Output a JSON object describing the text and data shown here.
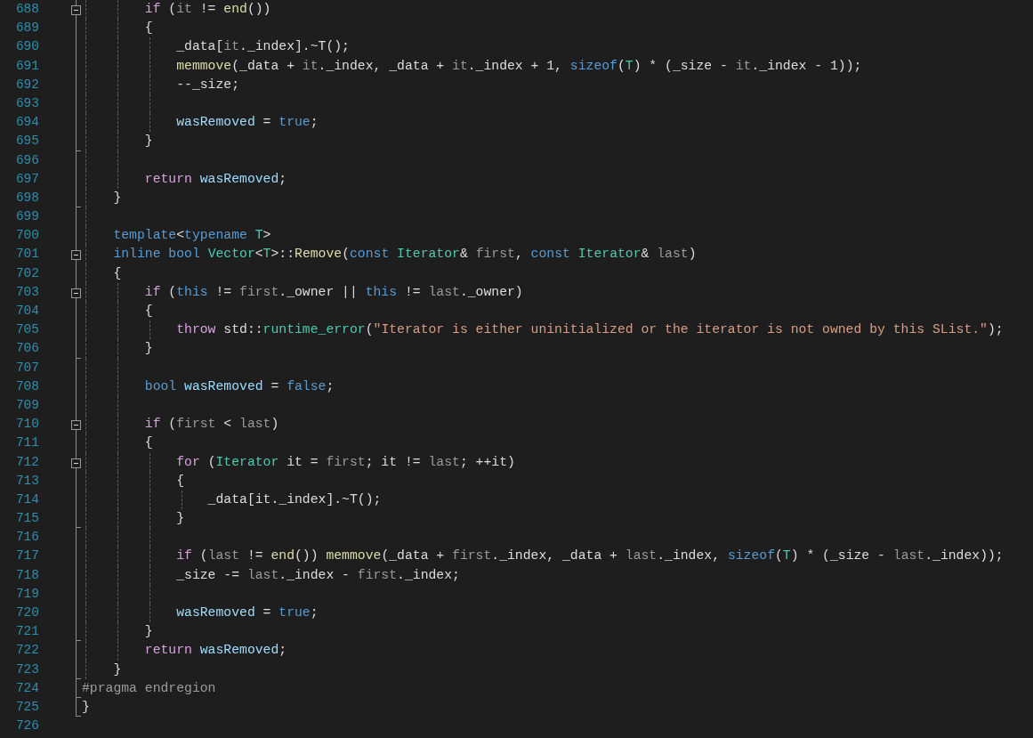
{
  "lines": [
    {
      "number": "688",
      "fold": {
        "expanded": true
      },
      "tokens": [
        {
          "kind": "control",
          "text": "        if"
        },
        {
          "kind": "plain",
          "text": " ("
        },
        {
          "kind": "param",
          "text": "it"
        },
        {
          "kind": "plain",
          "text": " != "
        },
        {
          "kind": "function",
          "text": "end"
        },
        {
          "kind": "plain",
          "text": "())"
        }
      ]
    },
    {
      "number": "689",
      "tokens": [
        {
          "kind": "plain",
          "text": "        {"
        }
      ]
    },
    {
      "number": "690",
      "tokens": [
        {
          "kind": "plain",
          "text": "            _data["
        },
        {
          "kind": "param",
          "text": "it"
        },
        {
          "kind": "plain",
          "text": "._index].~T();"
        }
      ]
    },
    {
      "number": "691",
      "tokens": [
        {
          "kind": "function",
          "text": "            memmove"
        },
        {
          "kind": "plain",
          "text": "(_data + "
        },
        {
          "kind": "param",
          "text": "it"
        },
        {
          "kind": "plain",
          "text": "._index, _data + "
        },
        {
          "kind": "param",
          "text": "it"
        },
        {
          "kind": "plain",
          "text": "._index + 1, "
        },
        {
          "kind": "keyword",
          "text": "sizeof"
        },
        {
          "kind": "plain",
          "text": "("
        },
        {
          "kind": "type",
          "text": "T"
        },
        {
          "kind": "plain",
          "text": ") * (_size - "
        },
        {
          "kind": "param",
          "text": "it"
        },
        {
          "kind": "plain",
          "text": "._index - 1));"
        }
      ]
    },
    {
      "number": "692",
      "tokens": [
        {
          "kind": "plain",
          "text": "            --_size;"
        }
      ]
    },
    {
      "number": "693"
    },
    {
      "number": "694",
      "tokens": [
        {
          "kind": "local",
          "text": "            wasRemoved"
        },
        {
          "kind": "plain",
          "text": " = "
        },
        {
          "kind": "keyword",
          "text": "true"
        },
        {
          "kind": "plain",
          "text": ";"
        }
      ]
    },
    {
      "number": "695",
      "fold_end": true,
      "tokens": [
        {
          "kind": "plain",
          "text": "        }"
        }
      ]
    },
    {
      "number": "696"
    },
    {
      "number": "697",
      "tokens": [
        {
          "kind": "control",
          "text": "        return"
        },
        {
          "kind": "local",
          "text": " wasRemoved"
        },
        {
          "kind": "plain",
          "text": ";"
        }
      ]
    },
    {
      "number": "698",
      "fold_end": true,
      "tokens": [
        {
          "kind": "plain",
          "text": "    }"
        }
      ]
    },
    {
      "number": "699"
    },
    {
      "number": "700",
      "tokens": [
        {
          "kind": "keyword",
          "text": "    template"
        },
        {
          "kind": "plain",
          "text": "<"
        },
        {
          "kind": "keyword",
          "text": "typename"
        },
        {
          "kind": "type",
          "text": " T"
        },
        {
          "kind": "plain",
          "text": ">"
        }
      ]
    },
    {
      "number": "701",
      "fold": {
        "expanded": true
      },
      "tokens": [
        {
          "kind": "keyword",
          "text": "    inline"
        },
        {
          "kind": "keyword",
          "text": " bool"
        },
        {
          "kind": "type",
          "text": " Vector"
        },
        {
          "kind": "plain",
          "text": "<"
        },
        {
          "kind": "type",
          "text": "T"
        },
        {
          "kind": "plain",
          "text": ">::"
        },
        {
          "kind": "function",
          "text": "Remove"
        },
        {
          "kind": "plain",
          "text": "("
        },
        {
          "kind": "keyword",
          "text": "const"
        },
        {
          "kind": "type",
          "text": " Iterator"
        },
        {
          "kind": "plain",
          "text": "& "
        },
        {
          "kind": "param",
          "text": "first"
        },
        {
          "kind": "plain",
          "text": ", "
        },
        {
          "kind": "keyword",
          "text": "const"
        },
        {
          "kind": "type",
          "text": " Iterator"
        },
        {
          "kind": "plain",
          "text": "& "
        },
        {
          "kind": "param",
          "text": "last"
        },
        {
          "kind": "plain",
          "text": ")"
        }
      ]
    },
    {
      "number": "702",
      "tokens": [
        {
          "kind": "plain",
          "text": "    {"
        }
      ]
    },
    {
      "number": "703",
      "fold": {
        "expanded": true
      },
      "tokens": [
        {
          "kind": "control",
          "text": "        if"
        },
        {
          "kind": "plain",
          "text": " ("
        },
        {
          "kind": "keyword",
          "text": "this"
        },
        {
          "kind": "plain",
          "text": " != "
        },
        {
          "kind": "param",
          "text": "first"
        },
        {
          "kind": "plain",
          "text": "._owner || "
        },
        {
          "kind": "keyword",
          "text": "this"
        },
        {
          "kind": "plain",
          "text": " != "
        },
        {
          "kind": "param",
          "text": "last"
        },
        {
          "kind": "plain",
          "text": "._owner)"
        }
      ]
    },
    {
      "number": "704",
      "tokens": [
        {
          "kind": "plain",
          "text": "        {"
        }
      ]
    },
    {
      "number": "705",
      "tokens": [
        {
          "kind": "control",
          "text": "            throw"
        },
        {
          "kind": "plain",
          "text": " std::"
        },
        {
          "kind": "type",
          "text": "runtime_error"
        },
        {
          "kind": "plain",
          "text": "("
        },
        {
          "kind": "string",
          "text": "\"Iterator is either uninitialized or the iterator is not owned by this SList.\""
        },
        {
          "kind": "plain",
          "text": ");"
        }
      ]
    },
    {
      "number": "706",
      "fold_end": true,
      "tokens": [
        {
          "kind": "plain",
          "text": "        }"
        }
      ]
    },
    {
      "number": "707"
    },
    {
      "number": "708",
      "tokens": [
        {
          "kind": "keyword",
          "text": "        bool"
        },
        {
          "kind": "local",
          "text": " wasRemoved"
        },
        {
          "kind": "plain",
          "text": " = "
        },
        {
          "kind": "keyword",
          "text": "false"
        },
        {
          "kind": "plain",
          "text": ";"
        }
      ]
    },
    {
      "number": "709"
    },
    {
      "number": "710",
      "fold": {
        "expanded": true
      },
      "tokens": [
        {
          "kind": "control",
          "text": "        if"
        },
        {
          "kind": "plain",
          "text": " ("
        },
        {
          "kind": "param",
          "text": "first"
        },
        {
          "kind": "plain",
          "text": " < "
        },
        {
          "kind": "param",
          "text": "last"
        },
        {
          "kind": "plain",
          "text": ")"
        }
      ]
    },
    {
      "number": "711",
      "tokens": [
        {
          "kind": "plain",
          "text": "        {"
        }
      ]
    },
    {
      "number": "712",
      "fold": {
        "expanded": true
      },
      "tokens": [
        {
          "kind": "control",
          "text": "            for"
        },
        {
          "kind": "plain",
          "text": " ("
        },
        {
          "kind": "type",
          "text": "Iterator"
        },
        {
          "kind": "plain",
          "text": " it = "
        },
        {
          "kind": "param",
          "text": "first"
        },
        {
          "kind": "plain",
          "text": "; it != "
        },
        {
          "kind": "param",
          "text": "last"
        },
        {
          "kind": "plain",
          "text": "; ++it)"
        }
      ]
    },
    {
      "number": "713",
      "tokens": [
        {
          "kind": "plain",
          "text": "            {"
        }
      ]
    },
    {
      "number": "714",
      "tokens": [
        {
          "kind": "plain",
          "text": "                _data[it._index].~T();"
        }
      ]
    },
    {
      "number": "715",
      "fold_end": true,
      "tokens": [
        {
          "kind": "plain",
          "text": "            }"
        }
      ]
    },
    {
      "number": "716"
    },
    {
      "number": "717",
      "tokens": [
        {
          "kind": "control",
          "text": "            if"
        },
        {
          "kind": "plain",
          "text": " ("
        },
        {
          "kind": "param",
          "text": "last"
        },
        {
          "kind": "plain",
          "text": " != "
        },
        {
          "kind": "function",
          "text": "end"
        },
        {
          "kind": "plain",
          "text": "()) "
        },
        {
          "kind": "function",
          "text": "memmove"
        },
        {
          "kind": "plain",
          "text": "(_data + "
        },
        {
          "kind": "param",
          "text": "first"
        },
        {
          "kind": "plain",
          "text": "._index, _data + "
        },
        {
          "kind": "param",
          "text": "last"
        },
        {
          "kind": "plain",
          "text": "._index, "
        },
        {
          "kind": "keyword",
          "text": "sizeof"
        },
        {
          "kind": "plain",
          "text": "("
        },
        {
          "kind": "type",
          "text": "T"
        },
        {
          "kind": "plain",
          "text": ") * (_size - "
        },
        {
          "kind": "param",
          "text": "last"
        },
        {
          "kind": "plain",
          "text": "._index));"
        }
      ]
    },
    {
      "number": "718",
      "tokens": [
        {
          "kind": "plain",
          "text": "            _size -= "
        },
        {
          "kind": "param",
          "text": "last"
        },
        {
          "kind": "plain",
          "text": "._index - "
        },
        {
          "kind": "param",
          "text": "first"
        },
        {
          "kind": "plain",
          "text": "._index;"
        }
      ]
    },
    {
      "number": "719"
    },
    {
      "number": "720",
      "tokens": [
        {
          "kind": "local",
          "text": "            wasRemoved"
        },
        {
          "kind": "plain",
          "text": " = "
        },
        {
          "kind": "keyword",
          "text": "true"
        },
        {
          "kind": "plain",
          "text": ";"
        }
      ]
    },
    {
      "number": "721",
      "fold_end": true,
      "tokens": [
        {
          "kind": "plain",
          "text": "        }"
        }
      ]
    },
    {
      "number": "722",
      "tokens": [
        {
          "kind": "control",
          "text": "        return"
        },
        {
          "kind": "local",
          "text": " wasRemoved"
        },
        {
          "kind": "plain",
          "text": ";"
        }
      ]
    },
    {
      "number": "723",
      "fold_end": true,
      "tokens": [
        {
          "kind": "plain",
          "text": "    }"
        }
      ]
    },
    {
      "number": "724",
      "fold_end": true,
      "tokens": [
        {
          "kind": "preprocessor",
          "text": "#pragma endregion"
        }
      ]
    },
    {
      "number": "725",
      "fold_end": true,
      "tokens": [
        {
          "kind": "plain",
          "text": "}"
        }
      ]
    },
    {
      "number": "726"
    }
  ]
}
